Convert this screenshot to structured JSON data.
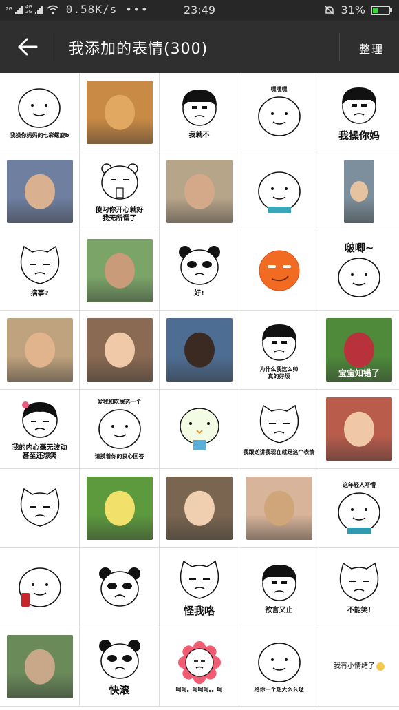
{
  "status_bar": {
    "network_labels": [
      "2G",
      "4G",
      "2G"
    ],
    "speed": "0.58K/s",
    "more": "•••",
    "time": "23:49",
    "battery": "31%",
    "battery_level": 0.31
  },
  "header": {
    "back_icon": "arrow-left-icon",
    "title": "我添加的表情(300)",
    "action": "整理"
  },
  "stickers": [
    {
      "kind": "doodle",
      "caption": "我操你妈妈的七彩螺旋b",
      "size": "sm"
    },
    {
      "kind": "photo",
      "caption": "",
      "bg": "#c88a45",
      "face": "#e0a860"
    },
    {
      "kind": "bowl",
      "caption": "我就不",
      "size": "normal"
    },
    {
      "kind": "doodle",
      "caption": "嘿嘿嘿",
      "size": "sm",
      "top": true
    },
    {
      "kind": "bowl",
      "caption": "我操你妈",
      "size": "big"
    },
    {
      "kind": "photo",
      "caption": "",
      "bg": "#6f7fa0",
      "face": "#d9b090"
    },
    {
      "kind": "bear",
      "caption": "傻叼你开心就好\n我无所谓了",
      "size": "normal"
    },
    {
      "kind": "photo",
      "caption": "",
      "bg": "#b7a58a",
      "face": "#d3a98a"
    },
    {
      "kind": "doodle",
      "caption": "",
      "size": "sm",
      "shirt": "#3aa6b9"
    },
    {
      "kind": "photo",
      "caption": "",
      "bg": "#7d8f9c",
      "face": "#e6c3a0",
      "narrow": true
    },
    {
      "kind": "cat",
      "caption": "搞事?",
      "size": "normal"
    },
    {
      "kind": "photo",
      "caption": "",
      "bg": "#7aa468",
      "face": "#c99b78"
    },
    {
      "kind": "panda",
      "caption": "好!",
      "size": "normal"
    },
    {
      "kind": "emoji",
      "caption": ""
    },
    {
      "kind": "doodle",
      "caption": "啵唧~",
      "size": "big",
      "top": true
    },
    {
      "kind": "photo",
      "caption": "",
      "bg": "#bfa27e",
      "face": "#e2b48e"
    },
    {
      "kind": "photo",
      "caption": "",
      "bg": "#8a6a52",
      "face": "#f0c9a8"
    },
    {
      "kind": "photo",
      "caption": "",
      "bg": "#4e6d93",
      "face": "#3b2a22"
    },
    {
      "kind": "bowl",
      "caption": "为什么我这么帅\n真的好烦",
      "size": "sm"
    },
    {
      "kind": "photo",
      "caption": "宝宝知错了",
      "bg": "#4e8a3a",
      "face": "#b8323c",
      "tag": true
    },
    {
      "kind": "girl",
      "caption": "我的内心毫无波动\n甚至还想笑",
      "size": "normal"
    },
    {
      "kind": "doodle",
      "caption": "爱我和吃屎选一个",
      "size": "sm",
      "top": true,
      "bottom": "请摸着你的良心回答"
    },
    {
      "kind": "bird",
      "caption": ""
    },
    {
      "kind": "cat",
      "caption": "我跟逆讲我现在就是这个表情",
      "size": "sm"
    },
    {
      "kind": "photo",
      "caption": "",
      "bg": "#b95c4c",
      "face": "#f0c8a8"
    },
    {
      "kind": "cat",
      "caption": "",
      "size": "normal"
    },
    {
      "kind": "photo",
      "caption": "",
      "bg": "#5d9a3e",
      "face": "#f1e06a"
    },
    {
      "kind": "photo",
      "caption": "",
      "bg": "#7a6650",
      "face": "#f0cfb0"
    },
    {
      "kind": "photo",
      "caption": "",
      "bg": "#d8b49a",
      "face": "#cfa57a"
    },
    {
      "kind": "doodle",
      "caption": "这年轻人吓懵",
      "size": "sm",
      "top": true,
      "shirt": "#2f9ab0"
    },
    {
      "kind": "doodle",
      "caption": "",
      "size": "sm",
      "can": true
    },
    {
      "kind": "panda",
      "caption": "",
      "size": "normal"
    },
    {
      "kind": "cat",
      "caption": "怪我咯",
      "size": "big"
    },
    {
      "kind": "bowl",
      "caption": "欲言又止",
      "size": "normal"
    },
    {
      "kind": "cat",
      "caption": "不能笑!",
      "size": "normal"
    },
    {
      "kind": "photo",
      "caption": "",
      "bg": "#6a8a5a",
      "face": "#c8a888"
    },
    {
      "kind": "panda",
      "caption": "快滚",
      "size": "big"
    },
    {
      "kind": "flower",
      "caption": "呵呵。呵呵呵。。呵",
      "size": "sm"
    },
    {
      "kind": "doodle",
      "caption": "给你一个超大么么哒",
      "size": "sm"
    },
    {
      "kind": "text",
      "caption": "我有小情绪了",
      "size": "normal"
    }
  ]
}
